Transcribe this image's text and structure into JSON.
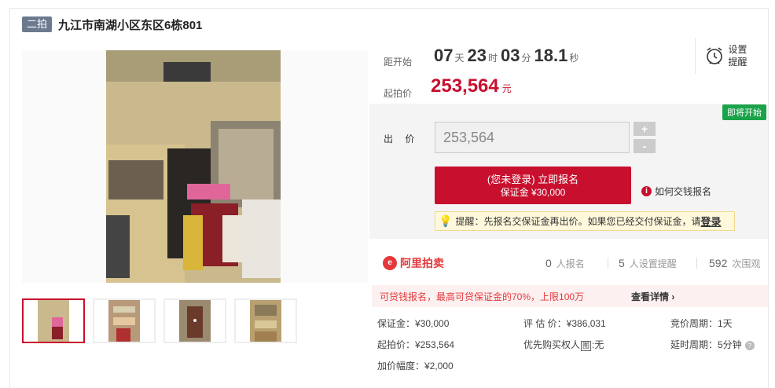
{
  "header": {
    "round_badge": "二拍",
    "title": "九江市南湖小区东区6栋801"
  },
  "gallery": {
    "thumbnail_count": 4,
    "active_index": 0
  },
  "countdown": {
    "label": "距开始",
    "days": "07",
    "days_unit": "天",
    "hours": "23",
    "hours_unit": "时",
    "minutes": "03",
    "minutes_unit": "分",
    "seconds": "18.1",
    "seconds_unit": "秒"
  },
  "start_price": {
    "label": "起拍价",
    "amount": "253,564",
    "currency": "元"
  },
  "remind": {
    "label_line1": "设置",
    "label_line2": "提醒"
  },
  "bid": {
    "soon_badge": "即将开始",
    "label": "出 价",
    "value": "253,564",
    "plus": "+",
    "minus": "-",
    "signup_main": "(您未登录) 立即报名",
    "signup_sub": "保证金 ¥30,000",
    "how_to_pay": "如何交钱报名",
    "tip_text": "提醒：先报名交保证金再出价。如果您已经交付保证金，请",
    "tip_login": "登录"
  },
  "stats": {
    "brand": "阿里拍卖",
    "brand_icon": "e",
    "signups": "0",
    "signups_label": "人报名",
    "reminders": "5",
    "reminders_label": "人设置提醒",
    "views": "592",
    "views_label": "次围观"
  },
  "loan": {
    "text": "可贷钱报名，最高可贷保证金的70%，上限100万",
    "link": "查看详情 ›"
  },
  "details": {
    "deposit": "保证金：¥30,000",
    "start": "起拍价：¥253,564",
    "increment": "加价幅度：¥2,000",
    "appraisal": "评 估 价：¥386,031",
    "priority_prefix": "优先购买权人",
    "priority_box": "图",
    "priority_suffix": ":无",
    "period": "竞价周期：1天",
    "delay": "延时周期：5分钟"
  },
  "colors": {
    "accent": "#c8102e",
    "badge_bg": "#6b7a8f",
    "soon_badge": "#1aa34a",
    "brand": "#e4393c"
  }
}
